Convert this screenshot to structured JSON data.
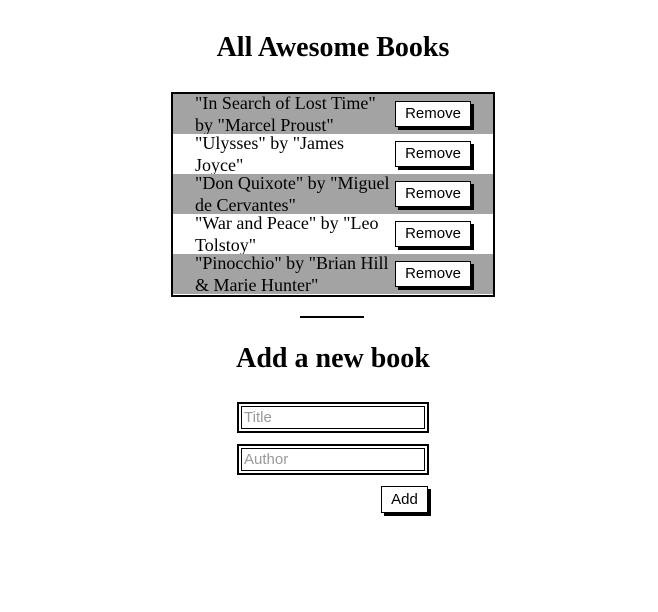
{
  "header": {
    "title": "All Awesome Books"
  },
  "books": [
    {
      "text": "\"In Search of Lost Time\" by \"Marcel Proust\"",
      "remove_label": "Remove"
    },
    {
      "text": "\"Ulysses\" by \"James Joyce\"",
      "remove_label": "Remove"
    },
    {
      "text": "\"Don Quixote\" by \"Miguel de Cervantes\"",
      "remove_label": "Remove"
    },
    {
      "text": "\"War and Peace\" by \"Leo Tolstoy\"",
      "remove_label": "Remove"
    },
    {
      "text": "\"Pinocchio\" by \"Brian Hill & Marie Hunter\"",
      "remove_label": "Remove"
    }
  ],
  "add_form": {
    "heading": "Add a new book",
    "title_value": "",
    "title_placeholder": "Title",
    "author_value": "",
    "author_placeholder": "Author",
    "submit_label": "Add"
  },
  "colors": {
    "row_shaded": "#a3a3a3",
    "row_plain": "#ffffff",
    "border": "#000000"
  }
}
